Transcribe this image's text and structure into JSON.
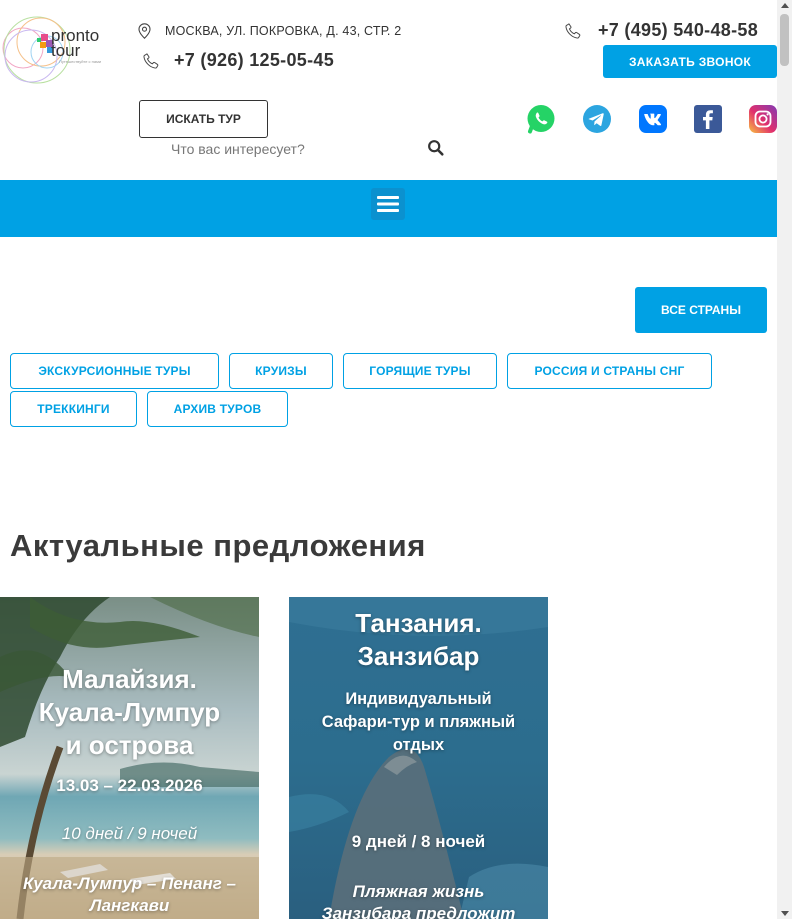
{
  "header": {
    "logo": {
      "word1": "pronto",
      "word2": "tour",
      "tagline": "Путешествуйте с нами"
    },
    "address": "МОСКВА, УЛ. ПОКРОВКА, Д. 43, СТР. 2",
    "phone_secondary": "+7 (926) 125-05-45",
    "phone_primary": "+7 (495) 540-48-58",
    "callback_label": "ЗАКАЗАТЬ ЗВОНОК",
    "search_tour_label": "ИСКАТЬ ТУР",
    "search": {
      "placeholder": "Что вас интересует?"
    },
    "socials": [
      "whatsapp-icon",
      "telegram-icon",
      "vk-icon",
      "facebook-icon",
      "instagram-icon"
    ]
  },
  "colors": {
    "accent": "#00a1e4",
    "text": "#333333",
    "whatsapp": "#25d366",
    "telegram": "#2ca5e0",
    "vk": "#0077ff",
    "facebook": "#3b5998"
  },
  "nav": {
    "menu_icon": "hamburger-icon"
  },
  "filters": {
    "all_countries_label": "ВСЕ СТРАНЫ",
    "categories": [
      "ЭКСКУРСИОННЫЕ ТУРЫ",
      "КРУИЗЫ",
      "ГОРЯЩИЕ ТУРЫ",
      "РОССИЯ И СТРАНЫ СНГ",
      "ТРЕККИНГИ",
      "АРХИВ ТУРОВ"
    ]
  },
  "offers": {
    "title": "Актуальные предложения",
    "cards": [
      {
        "title_line1": "Малайзия.",
        "title_line2": "Куала-Лумпур",
        "title_line3": "и острова",
        "dates": "13.03 – 22.03.2026",
        "duration": "10 дней / 9 ночей",
        "route_line1": "Куала-Лумпур – Пенанг –",
        "route_line2": "Лангкави"
      },
      {
        "title_line1": "Танзания.",
        "title_line2": "Занзибар",
        "subtitle_line1": "Индивидуальный",
        "subtitle_line2": "Сафари-тур и пляжный",
        "subtitle_line3": "отдых",
        "duration": "9 дней / 8 ночей",
        "desc_line1": "Пляжная жизнь",
        "desc_line2": "Занзибара предложит"
      }
    ]
  }
}
